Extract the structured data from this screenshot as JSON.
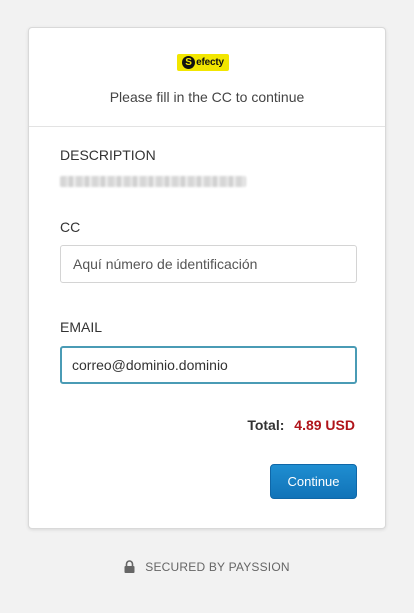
{
  "header": {
    "logo_text": "efecty",
    "logo_letter": "S",
    "subtitle": "Please fill in the CC to continue"
  },
  "description": {
    "label": "DESCRIPTION"
  },
  "cc": {
    "label": "CC",
    "placeholder": "Aquí número de identificación",
    "value": ""
  },
  "email": {
    "label": "EMAIL",
    "value": "correo@dominio.dominio"
  },
  "total": {
    "label": "Total:",
    "amount": "4.89 USD"
  },
  "continue_label": "Continue",
  "footer": {
    "text": "SECURED BY PAYSSION",
    "icon": "lock-icon"
  },
  "colors": {
    "accent": "#1a86c8",
    "focus_border": "#4a9bb5",
    "total_amount": "#b0141a",
    "logo_bg": "#f2e600"
  }
}
